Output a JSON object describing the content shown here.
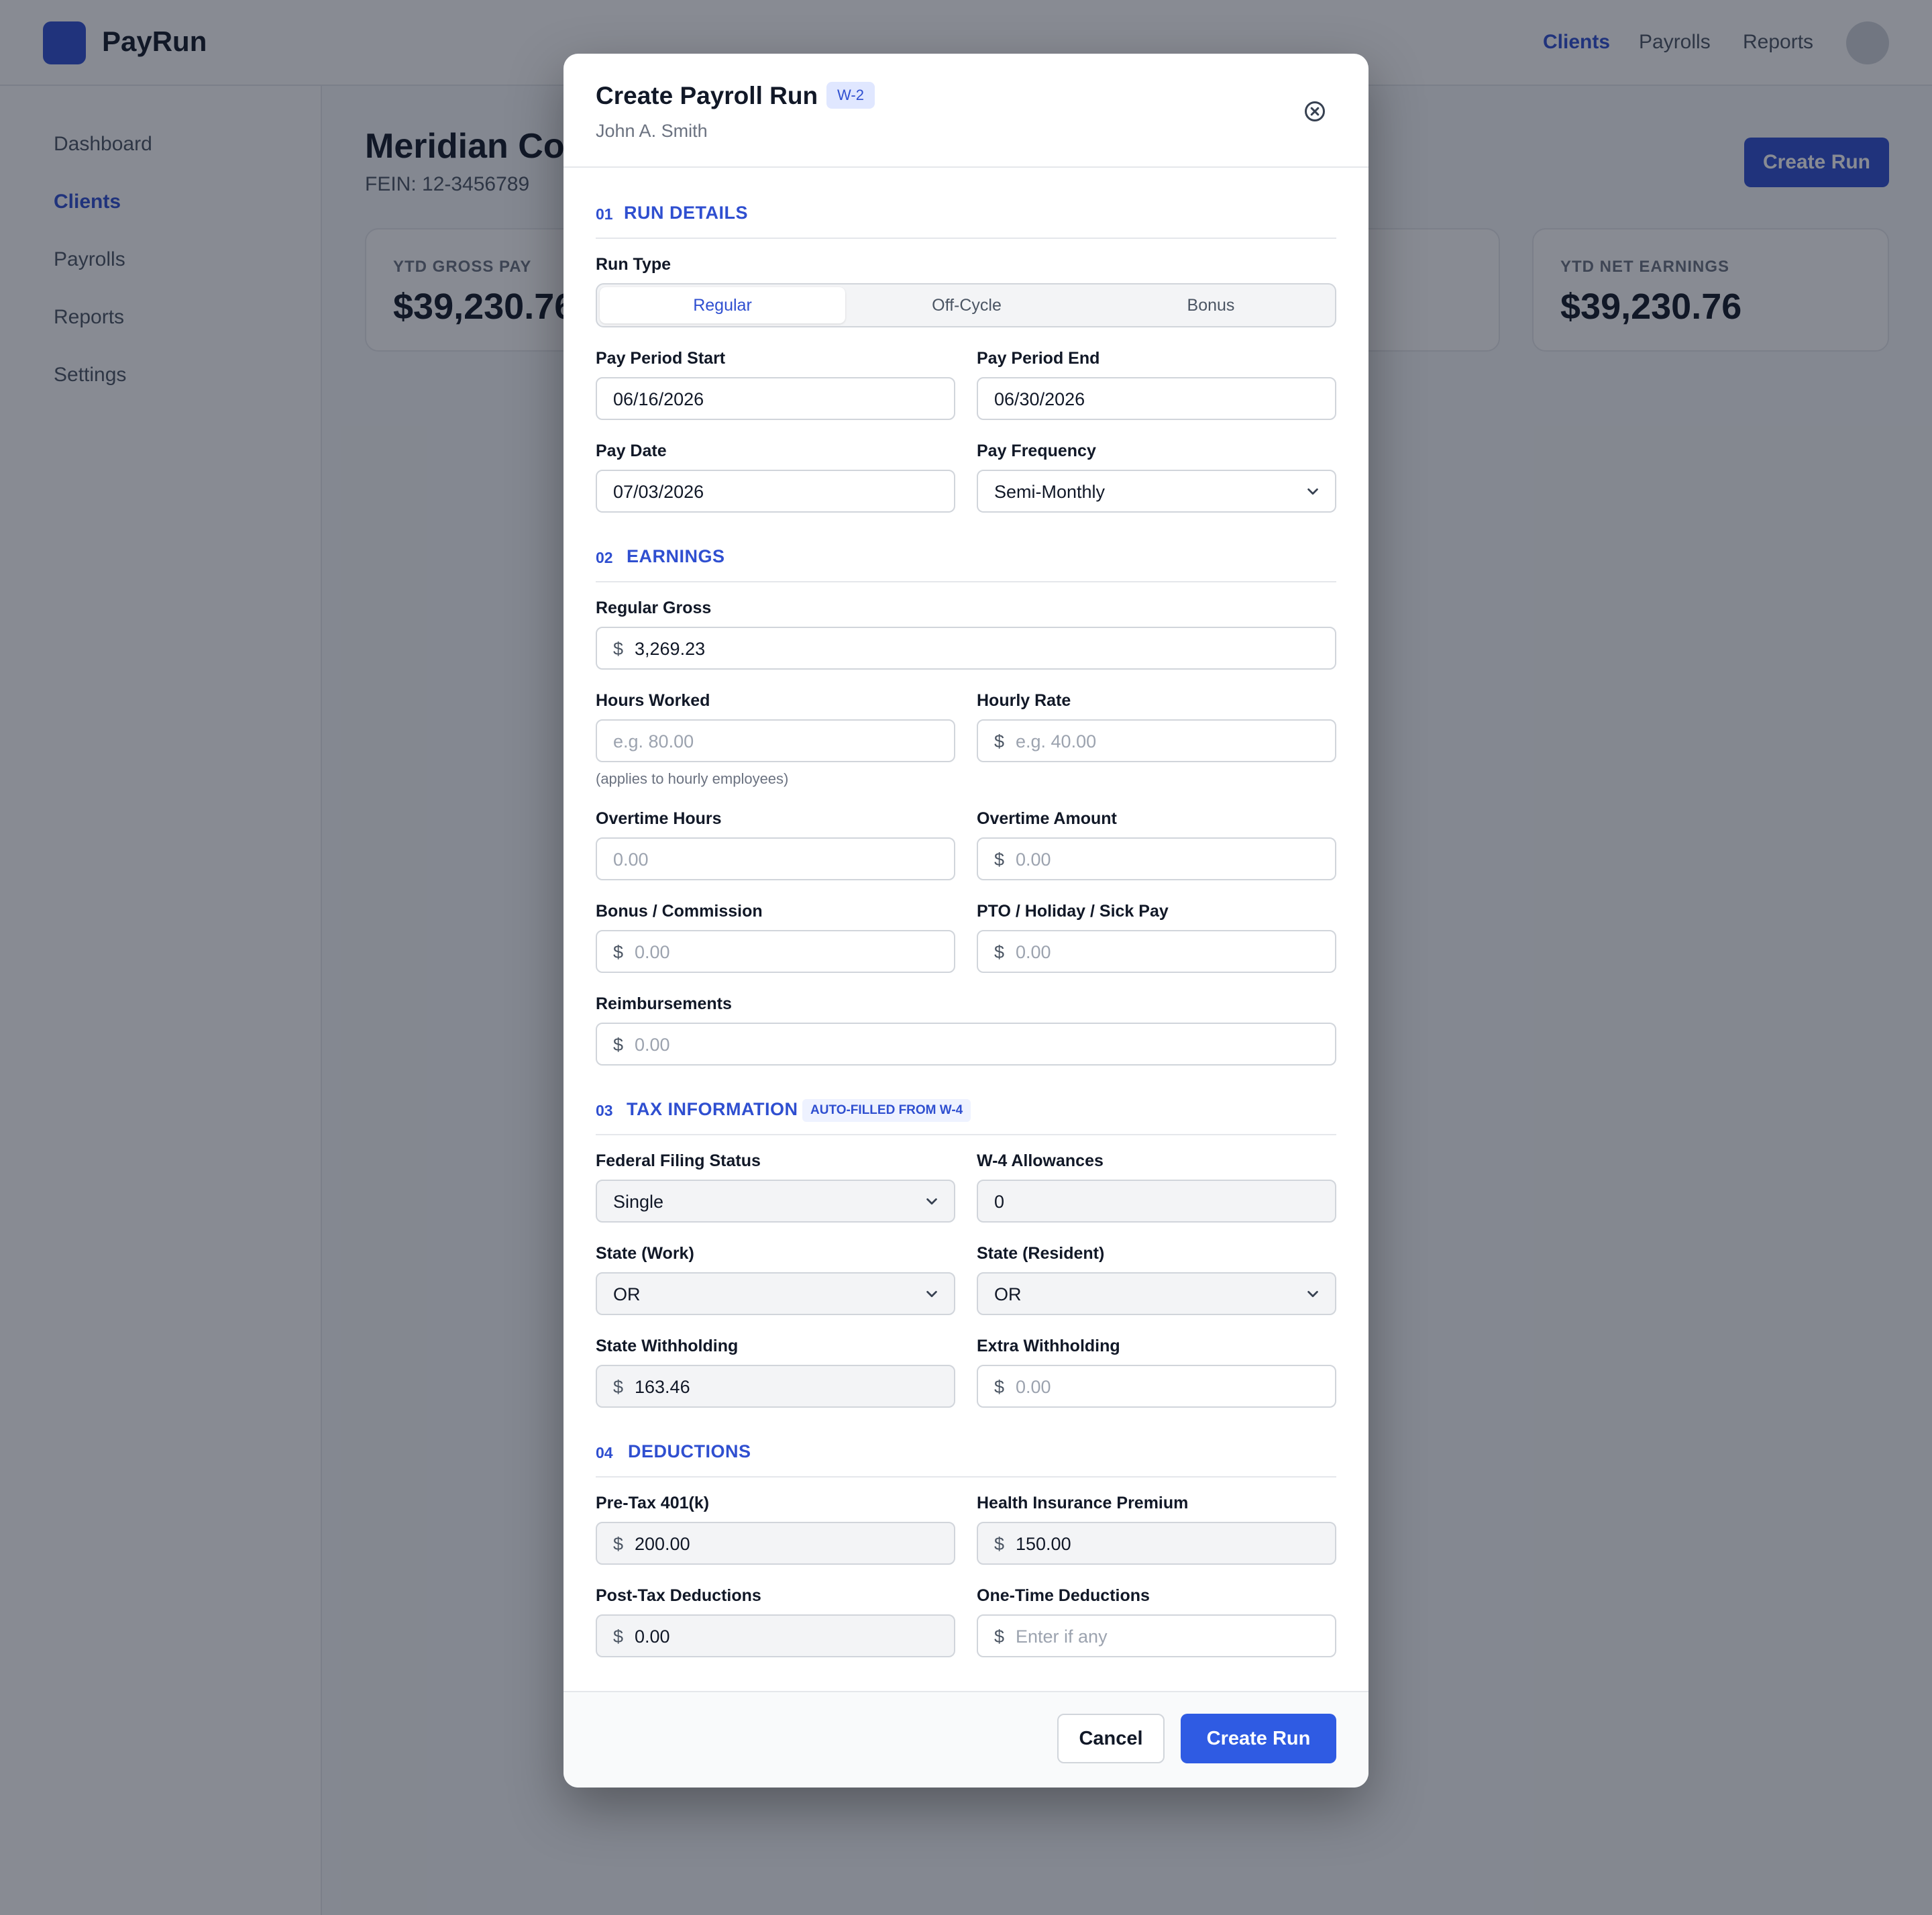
{
  "app": {
    "brand": "PayRun",
    "topnav": [
      "Clients",
      "Payrolls",
      "Reports"
    ],
    "sidebar": [
      "Dashboard",
      "Clients",
      "Payrolls",
      "Reports",
      "Settings"
    ],
    "company": {
      "name": "Meridian Cor",
      "fein": "FEIN: 12-3456789"
    },
    "create_run": "Create Run",
    "stats": [
      {
        "label": "YTD GROSS PAY",
        "value": "$39,230.76"
      },
      {
        "label": "YTD NET EARNINGS",
        "value": "$39,230.76"
      }
    ]
  },
  "modal": {
    "title": "Create Payroll Run",
    "badge": "W-2",
    "employee": "John A. Smith",
    "sections": [
      {
        "num": "01",
        "title": "RUN DETAILS"
      },
      {
        "num": "02",
        "title": "EARNINGS"
      },
      {
        "num": "03",
        "title": "TAX INFORMATION",
        "badge": "AUTO-FILLED FROM W-4"
      },
      {
        "num": "04",
        "title": "DEDUCTIONS"
      }
    ],
    "run_type": {
      "label": "Run Type",
      "options": [
        "Regular",
        "Off-Cycle",
        "Bonus"
      ],
      "selected": "Regular"
    },
    "currency": "$",
    "fields": {
      "pay_period_start": {
        "label": "Pay Period Start",
        "value": "06/16/2026"
      },
      "pay_period_end": {
        "label": "Pay Period End",
        "value": "06/30/2026"
      },
      "pay_date": {
        "label": "Pay Date",
        "value": "07/03/2026"
      },
      "pay_frequency": {
        "label": "Pay Frequency",
        "value": "Semi-Monthly"
      },
      "regular_gross": {
        "label": "Regular Gross",
        "value": "3,269.23"
      },
      "hours_worked": {
        "label": "Hours Worked",
        "placeholder": "e.g. 80.00",
        "hint": "(applies to hourly employees)"
      },
      "hourly_rate": {
        "label": "Hourly Rate",
        "placeholder": "e.g. 40.00"
      },
      "overtime_hours": {
        "label": "Overtime Hours",
        "placeholder": "0.00"
      },
      "overtime_amount": {
        "label": "Overtime Amount",
        "placeholder": "0.00"
      },
      "bonus_commission": {
        "label": "Bonus / Commission",
        "placeholder": "0.00"
      },
      "pto_pay": {
        "label": "PTO / Holiday / Sick Pay",
        "placeholder": "0.00"
      },
      "reimbursements": {
        "label": "Reimbursements",
        "placeholder": "0.00"
      },
      "federal_filing_status": {
        "label": "Federal Filing Status",
        "value": "Single"
      },
      "w4_allowances": {
        "label": "W-4 Allowances",
        "value": "0"
      },
      "state_work": {
        "label": "State (Work)",
        "value": "OR"
      },
      "state_resident": {
        "label": "State (Resident)",
        "value": "OR"
      },
      "state_withholding": {
        "label": "State Withholding",
        "value": "163.46"
      },
      "extra_withholding": {
        "label": "Extra Withholding",
        "placeholder": "0.00"
      },
      "pretax_401k": {
        "label": "Pre-Tax 401(k)",
        "value": "200.00"
      },
      "health_premium": {
        "label": "Health Insurance Premium",
        "value": "150.00"
      },
      "posttax_deductions": {
        "label": "Post-Tax Deductions",
        "value": "0.00"
      },
      "onetime_deductions": {
        "label": "One-Time Deductions",
        "placeholder": "Enter if any"
      }
    },
    "buttons": {
      "cancel": "Cancel",
      "create": "Create Run"
    }
  },
  "colors": {
    "accent": "#2f4fd0",
    "primary_button": "#2f5be3",
    "overlay": "rgba(17,24,39,0.5)"
  },
  "icons": {
    "close": "close-circle-icon",
    "dropdown": "chevron-down-icon"
  }
}
